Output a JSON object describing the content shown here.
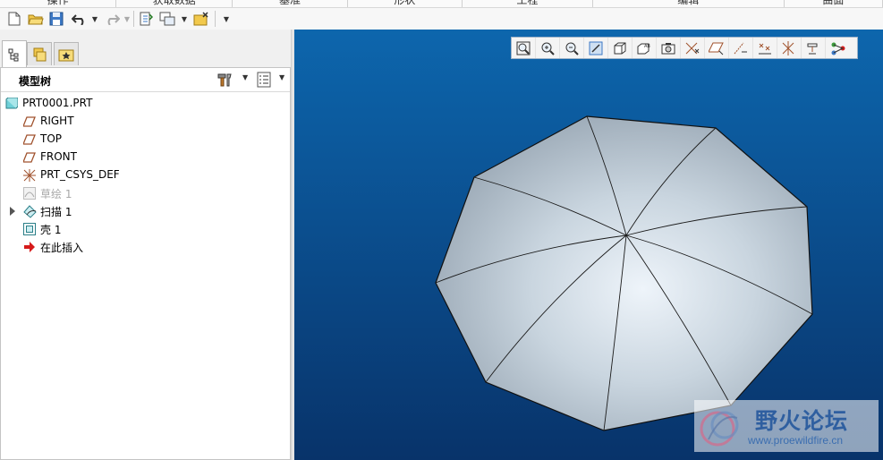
{
  "ribbon": {
    "tabs": [
      "操作",
      "获取数据",
      "基准",
      "形状",
      "工程",
      "编辑",
      "曲面"
    ]
  },
  "quick_access": {
    "icons": [
      "new-file-icon",
      "open-folder-icon",
      "save-icon",
      "undo-icon",
      "redo-icon",
      "regenerate-icon",
      "windows-icon",
      "close-window-icon",
      "customize-icon"
    ]
  },
  "navigator": {
    "tabs": [
      "model-tree-tab",
      "folder-browser-tab",
      "favorites-tab"
    ]
  },
  "model_tree": {
    "title": "模型树",
    "items": [
      {
        "label": "PRT0001.PRT",
        "icon": "part-icon",
        "dim": false,
        "expandable": false
      },
      {
        "label": "RIGHT",
        "icon": "datum-plane-icon",
        "dim": false,
        "expandable": false
      },
      {
        "label": "TOP",
        "icon": "datum-plane-icon",
        "dim": false,
        "expandable": false
      },
      {
        "label": "FRONT",
        "icon": "datum-plane-icon",
        "dim": false,
        "expandable": false
      },
      {
        "label": "PRT_CSYS_DEF",
        "icon": "coordinate-system-icon",
        "dim": false,
        "expandable": false
      },
      {
        "label": "草绘 1",
        "icon": "sketch-icon",
        "dim": true,
        "expandable": false
      },
      {
        "label": "扫描 1",
        "icon": "sweep-icon",
        "dim": false,
        "expandable": true
      },
      {
        "label": "壳 1",
        "icon": "shell-icon",
        "dim": false,
        "expandable": false
      },
      {
        "label": "在此插入",
        "icon": "insert-here-arrow-icon",
        "dim": false,
        "expandable": false
      }
    ]
  },
  "view_toolbar": {
    "icons": [
      "refit-icon",
      "zoom-in-icon",
      "zoom-out-icon",
      "repaint-icon",
      "display-style-icon",
      "saved-orientations-icon",
      "view-manager-icon",
      "datum-display-icon",
      "plane-display-icon",
      "axis-display-icon",
      "point-display-icon",
      "csys-display-icon",
      "spin-center-icon",
      "annotation-display-icon"
    ]
  },
  "colors": {
    "background_top": "#0d66ad",
    "background_bottom": "#08336a",
    "model_surface": "#c6d2dc",
    "insert_arrow": "#d61a1a"
  },
  "watermark": {
    "title": "野火论坛",
    "url": "www.proewildfire.cn"
  }
}
